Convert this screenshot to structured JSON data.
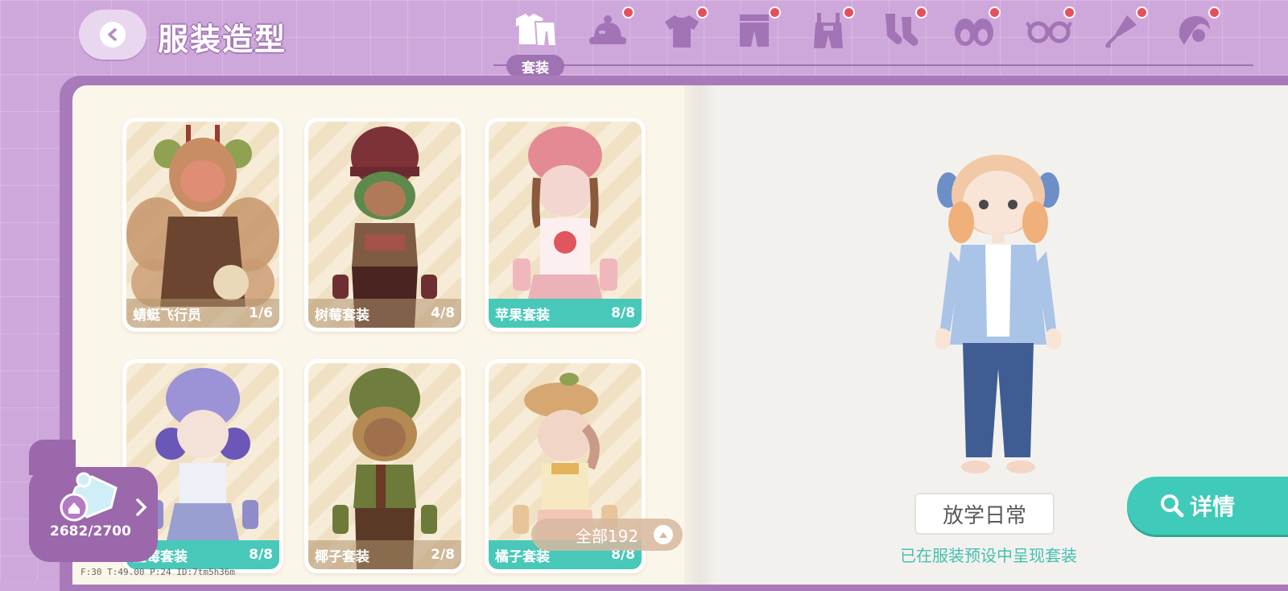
{
  "header": {
    "title": "服装造型",
    "active_tab_label": "套装",
    "tabs": [
      {
        "name": "outfit-set-icon",
        "badge": false
      },
      {
        "name": "hat-icon",
        "badge": true
      },
      {
        "name": "top-icon",
        "badge": true
      },
      {
        "name": "pants-icon",
        "badge": true
      },
      {
        "name": "overalls-icon",
        "badge": true
      },
      {
        "name": "socks-icon",
        "badge": true
      },
      {
        "name": "shoes-icon",
        "badge": true
      },
      {
        "name": "glasses-icon",
        "badge": true
      },
      {
        "name": "umbrella-icon",
        "badge": true
      },
      {
        "name": "hair-icon",
        "badge": true
      }
    ]
  },
  "outfits": [
    {
      "name": "蜻蜓飞行员",
      "count": "1/6",
      "complete": false
    },
    {
      "name": "树莓套装",
      "count": "4/8",
      "complete": false
    },
    {
      "name": "苹果套装",
      "count": "8/8",
      "complete": true
    },
    {
      "name": "蓝莓套装",
      "count": "8/8",
      "complete": true
    },
    {
      "name": "椰子套装",
      "count": "2/8",
      "complete": false
    },
    {
      "name": "橘子套装",
      "count": "8/8",
      "complete": true
    }
  ],
  "collection": {
    "puzzle_count": "2682/2700",
    "total_label": "全部192"
  },
  "debug": "F:30   T:49.00   P:24   ID:7tm5h36m",
  "preview": {
    "preset_name": "放学日常",
    "note": "已在服装预设中呈现套装",
    "detail_label": "详情"
  },
  "colors": {
    "accent_teal": "#44c0b0",
    "header_purple": "#cea8db",
    "frame_purple": "#a97ab9",
    "badge_red": "#e6505c"
  }
}
